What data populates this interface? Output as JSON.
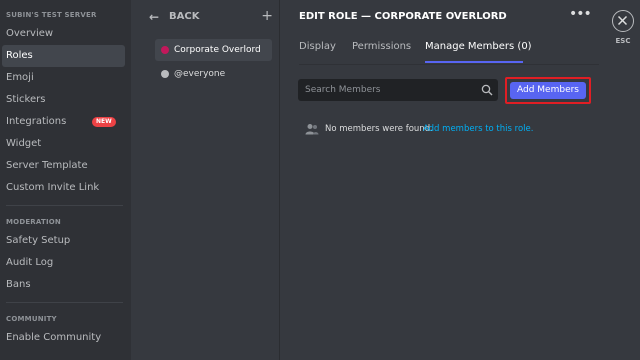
{
  "sidebar": {
    "server_header": "SUBIN'S TEST SERVER",
    "items": [
      {
        "label": "Overview"
      },
      {
        "label": "Roles"
      },
      {
        "label": "Emoji"
      },
      {
        "label": "Stickers"
      },
      {
        "label": "Integrations",
        "badge": "NEW"
      },
      {
        "label": "Widget"
      },
      {
        "label": "Server Template"
      },
      {
        "label": "Custom Invite Link"
      }
    ],
    "moderation_header": "MODERATION",
    "moderation_items": [
      {
        "label": "Safety Setup"
      },
      {
        "label": "Audit Log"
      },
      {
        "label": "Bans"
      }
    ],
    "community_header": "COMMUNITY",
    "community_items": [
      {
        "label": "Enable Community"
      }
    ]
  },
  "roles_panel": {
    "back_label": "BACK",
    "roles": [
      {
        "name": "Corporate Overlord",
        "color": "#c2185b",
        "selected": true
      },
      {
        "name": "@everyone",
        "color": "#b9bbbe",
        "selected": false
      }
    ]
  },
  "main": {
    "title": "EDIT ROLE — CORPORATE OVERLORD",
    "tabs": [
      {
        "label": "Display"
      },
      {
        "label": "Permissions"
      },
      {
        "label": "Manage Members (0)",
        "active": true
      }
    ],
    "search": {
      "placeholder": "Search Members",
      "value": ""
    },
    "add_button_label": "Add Members",
    "empty_text": "No members were found.",
    "empty_link": "Add members to this role."
  },
  "close": {
    "esc_label": "ESC"
  },
  "colors": {
    "accent": "#5865f2",
    "link": "#00aff4",
    "badge_red": "#ed4245",
    "highlight_red": "#e01e24"
  }
}
